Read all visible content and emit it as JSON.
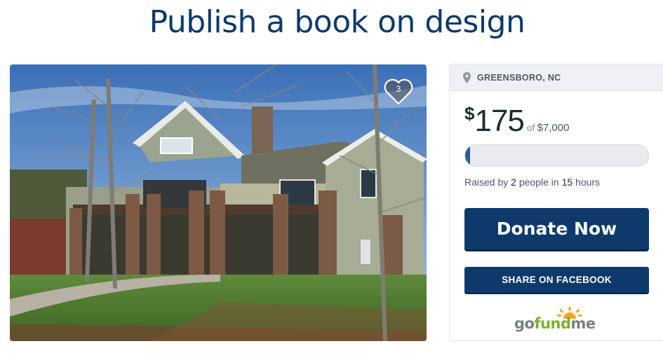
{
  "campaign": {
    "title": "Publish a book on design"
  },
  "hero": {
    "image": "house-photo",
    "heart_count": "3"
  },
  "sidebar": {
    "location": "GREENSBORO, NC",
    "currency_symbol": "$",
    "amount_raised": "175",
    "of_label": "of",
    "goal": "$7,000",
    "progress_fraction": 0.025,
    "raised_prefix": "Raised by",
    "donor_count": "2",
    "people_label": "people in",
    "time_value": "15",
    "time_unit": "hours",
    "donate_label": "Donate Now",
    "share_label": "SHARE ON FACEBOOK",
    "logo": {
      "go": "go",
      "fund": "fund",
      "me": "me"
    }
  },
  "colors": {
    "brand_navy": "#0e3a6b",
    "progress_fill": "#2b5d99",
    "logo_green": "#7ab32e",
    "logo_gray": "#7b7f83",
    "logo_sun": "#f4a51c"
  }
}
